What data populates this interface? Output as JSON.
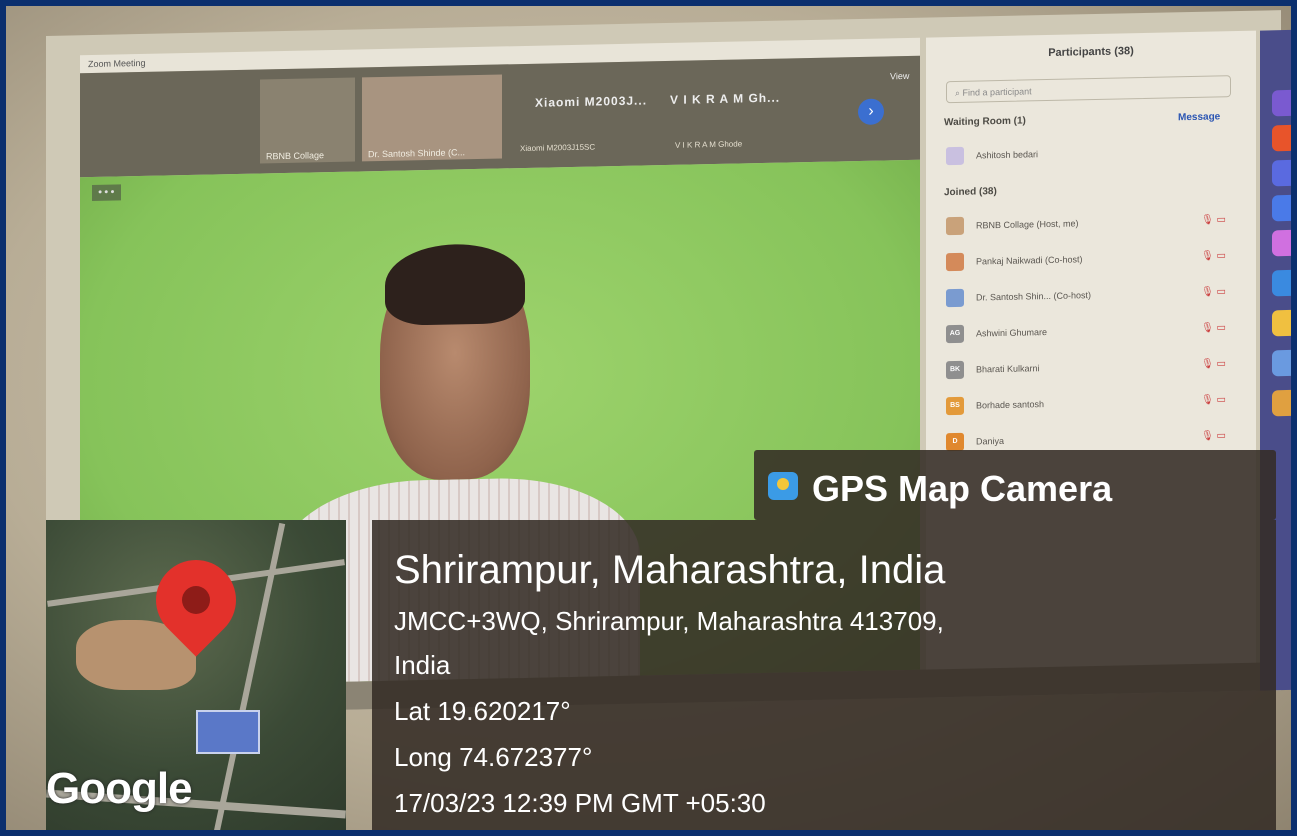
{
  "zoom": {
    "window_title": "Zoom Meeting",
    "view_label": "View",
    "thumbnails": [
      {
        "label": "RBNB Collage"
      },
      {
        "label": "Dr. Santosh Shinde (C..."
      },
      {
        "label": "Xiaomi M2003J15SC"
      },
      {
        "label": "V I K R A M  Ghode"
      }
    ],
    "thumb_names": [
      "Xiaomi M2003J...",
      "V I K R A M  Gh..."
    ],
    "participants_title": "Participants (38)",
    "search_placeholder": "Find a participant",
    "waiting_room": "Waiting Room (1)",
    "message_label": "Message",
    "waiting_person": "Ashitosh bedari",
    "joined_label": "Joined (38)",
    "participants": [
      {
        "initials": "",
        "name": "RBNB Collage (Host, me)",
        "color": "#c9a27a"
      },
      {
        "initials": "",
        "name": "Pankaj Naikwadi (Co-host)",
        "color": "#d48a5a"
      },
      {
        "initials": "",
        "name": "Dr. Santosh Shin... (Co-host)",
        "color": "#7a9bd0"
      },
      {
        "initials": "AG",
        "name": "Ashwini Ghumare",
        "color": "#8f8f8f"
      },
      {
        "initials": "BK",
        "name": "Bharati Kulkarni",
        "color": "#8f8f8f"
      },
      {
        "initials": "BS",
        "name": "Borhade santosh",
        "color": "#e39a3a"
      },
      {
        "initials": "D",
        "name": "Daniya",
        "color": "#e0882e"
      }
    ]
  },
  "overlay": {
    "banner_text": "GPS Map Camera",
    "location": "Shrirampur, Maharashtra, India",
    "address_line1": "JMCC+3WQ, Shrirampur, Maharashtra 413709,",
    "address_line2": "India",
    "lat": "Lat 19.620217°",
    "long": "Long 74.672377°",
    "datetime": "17/03/23 12:39 PM GMT +05:30",
    "map_brand": "Google"
  },
  "colors": {
    "border": "#0b2f6e",
    "green_screen": "#86c35a",
    "pin": "#e3312b",
    "overlay_bg": "#342c26"
  }
}
